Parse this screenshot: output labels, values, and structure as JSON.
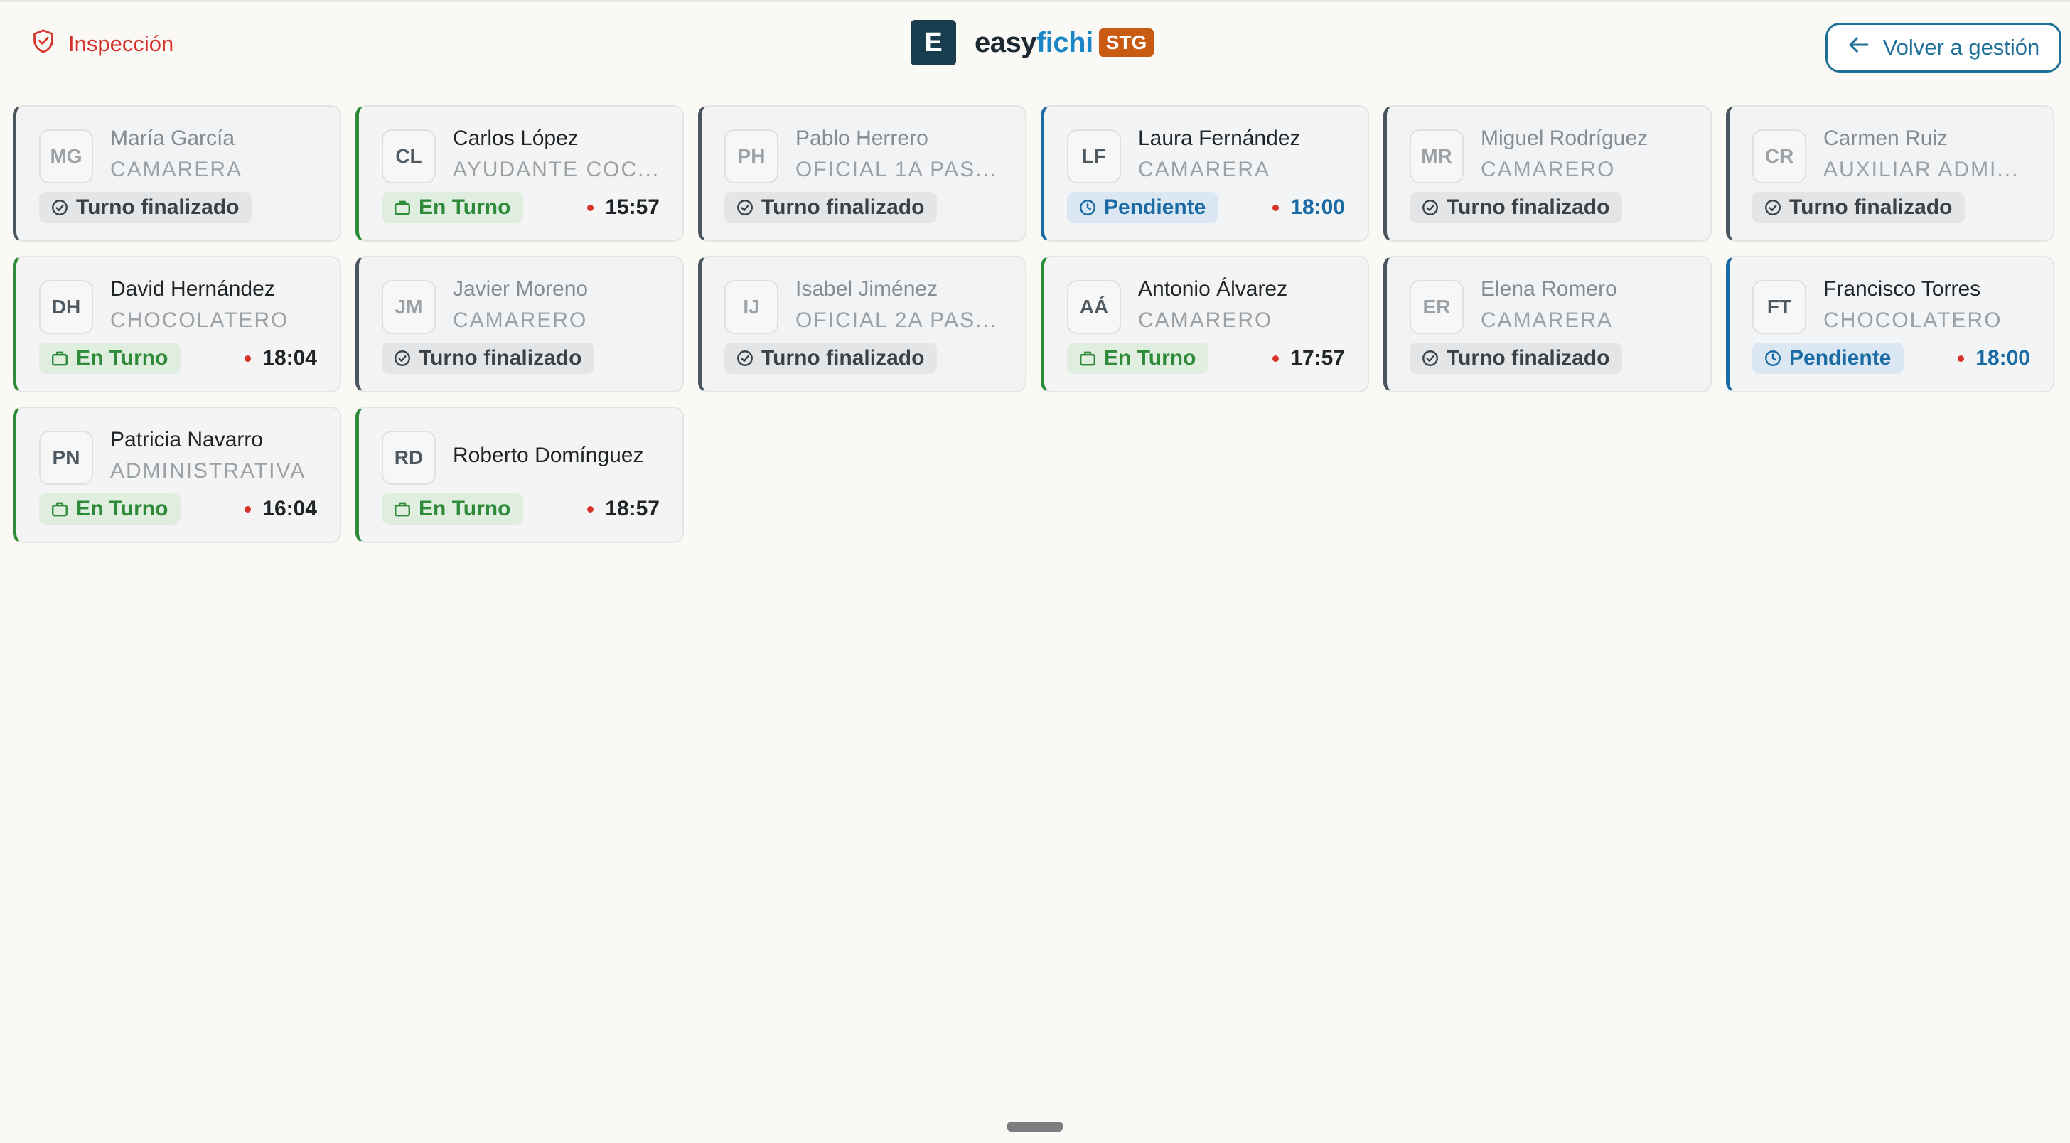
{
  "header": {
    "inspection_label": "Inspección",
    "brand_logo_letter": "E",
    "brand_name_part1": "easy",
    "brand_name_part2": "fichi",
    "brand_badge": "STG",
    "back_label": "Volver a gestión",
    "inspection_color": "#d6342b",
    "brand_accent": "#1a86c7",
    "badge_color": "#c85a12"
  },
  "employees": [
    {
      "initials": "MG",
      "name": "María García",
      "role": "CAMARERA",
      "status": "Turno finalizado",
      "time": ""
    },
    {
      "initials": "CL",
      "name": "Carlos López",
      "role": "AYUDANTE COC...",
      "status": "En Turno",
      "time": "15:57"
    },
    {
      "initials": "PH",
      "name": "Pablo Herrero",
      "role": "OFICIAL 1A PAS...",
      "status": "Turno finalizado",
      "time": ""
    },
    {
      "initials": "LF",
      "name": "Laura Fernández",
      "role": "CAMARERA",
      "status": "Pendiente",
      "time": "18:00"
    },
    {
      "initials": "MR",
      "name": "Miguel Rodríguez",
      "role": "CAMARERO",
      "status": "Turno finalizado",
      "time": ""
    },
    {
      "initials": "CR",
      "name": "Carmen Ruiz",
      "role": "AUXILIAR ADMI...",
      "status": "Turno finalizado",
      "time": ""
    },
    {
      "initials": "DH",
      "name": "David Hernández",
      "role": "CHOCOLATERO",
      "status": "En Turno",
      "time": "18:04"
    },
    {
      "initials": "JM",
      "name": "Javier Moreno",
      "role": "CAMARERO",
      "status": "Turno finalizado",
      "time": ""
    },
    {
      "initials": "IJ",
      "name": "Isabel Jiménez",
      "role": "OFICIAL 2A PAS...",
      "status": "Turno finalizado",
      "time": ""
    },
    {
      "initials": "AÁ",
      "name": "Antonio Álvarez",
      "role": "CAMARERO",
      "status": "En Turno",
      "time": "17:57"
    },
    {
      "initials": "ER",
      "name": "Elena Romero",
      "role": "CAMARERA",
      "status": "Turno finalizado",
      "time": ""
    },
    {
      "initials": "FT",
      "name": "Francisco Torres",
      "role": "CHOCOLATERO",
      "status": "Pendiente",
      "time": "18:00"
    },
    {
      "initials": "PN",
      "name": "Patricia Navarro",
      "role": "ADMINISTRATIVA",
      "status": "En Turno",
      "time": "16:04"
    },
    {
      "initials": "RD",
      "name": "Roberto Domínguez",
      "role": "",
      "status": "En Turno",
      "time": "18:57"
    }
  ],
  "status_colors": {
    "finished": "#4a5560",
    "on_shift": "#2e8b3a",
    "pending": "#1a6aa3"
  }
}
